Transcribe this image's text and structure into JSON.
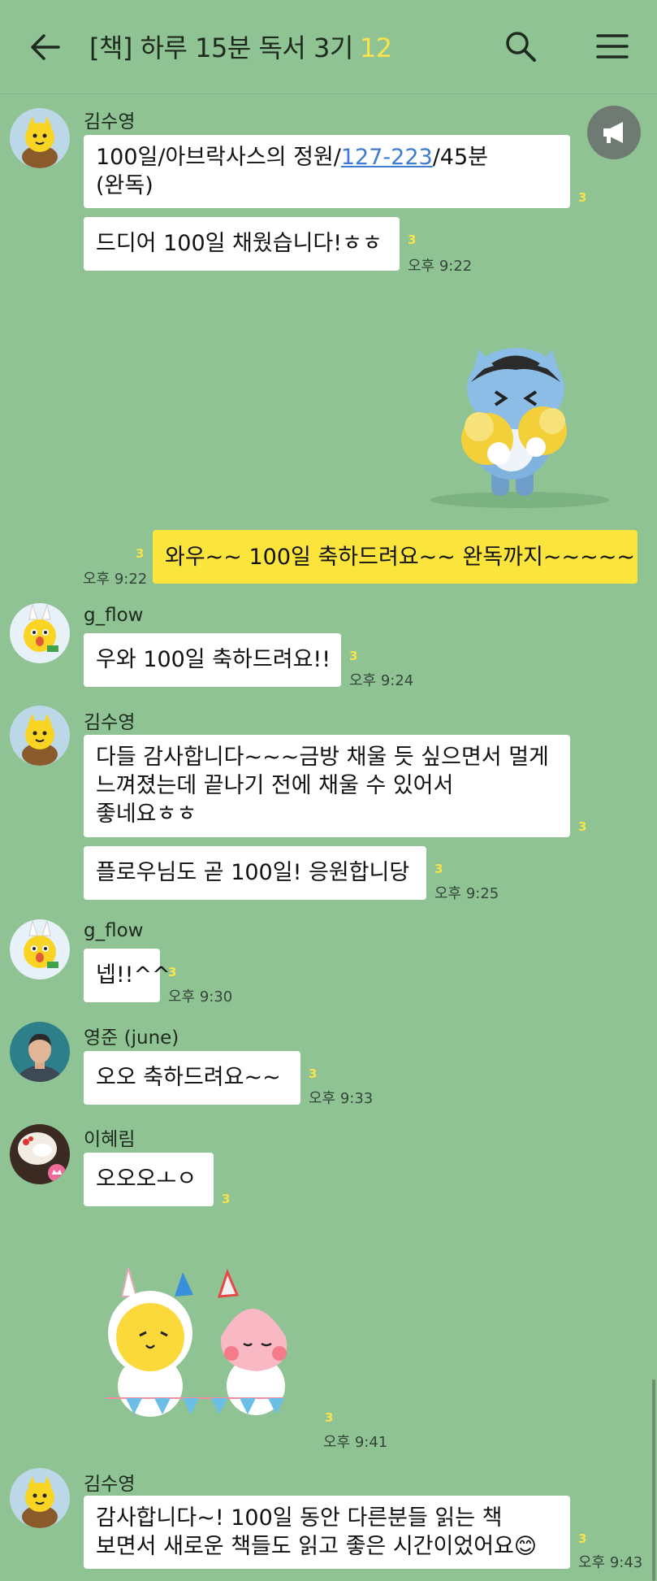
{
  "header": {
    "title": "[책] 하루 15분 독서 3기",
    "member_count": "12",
    "icons": [
      "back-arrow-icon",
      "search-icon",
      "menu-icon"
    ]
  },
  "colors": {
    "background": "#8FC394",
    "my_bubble": "#FBE53C",
    "other_bubble": "#FFFFFF",
    "unread": "#F8E34A",
    "link": "#3D7BD1"
  },
  "messages": {
    "m1": {
      "sender": "김수영",
      "line1_pre": "100일/아브락사스의 정원/",
      "line1_link": "127-223",
      "line1_post": "/45분",
      "line2": "(완독)",
      "unread": "3"
    },
    "m2": {
      "text": "드디어 100일 채웠습니다!ㅎㅎ",
      "unread": "3",
      "time": "오후 9:22"
    },
    "m3": {
      "type": "sticker",
      "sticker": "ryan-cheering-pompom-sticker"
    },
    "m4": {
      "text": "와우~~ 100일 축하드려요~~ 완독까지~~~~~",
      "unread": "3",
      "time": "오후 9:22"
    },
    "m5": {
      "sender": "g_flow",
      "text": "우와 100일 축하드려요!!",
      "unread": "3",
      "time": "오후 9:24"
    },
    "m6": {
      "sender": "김수영",
      "line1": "다들 감사합니다~~~금방 채울 듯 싶으면서 멀게",
      "line2": "느껴졌는데 끝나기 전에 채울 수 있어서",
      "line3": "좋네요ㅎㅎ",
      "unread": "3"
    },
    "m7": {
      "text": "플로우님도 곧 100일! 응원합니당",
      "unread": "3",
      "time": "오후 9:25"
    },
    "m8": {
      "sender": "g_flow",
      "text": "넵!!^^",
      "unread": "3",
      "time": "오후 9:30"
    },
    "m9": {
      "sender": "영준 (june)",
      "text": "오오 축하드려요~~",
      "unread": "3",
      "time": "오후 9:33"
    },
    "m10": {
      "sender": "이혜림",
      "text": "오오오ㅗㅇ",
      "unread": "3"
    },
    "m11": {
      "type": "sticker",
      "sticker": "muzi-apeach-happy-banner-sticker",
      "unread": "3",
      "time": "오후 9:41"
    },
    "m12": {
      "sender": "김수영",
      "line1": "감사합니다~! 100일 동안 다른분들 읽는 책",
      "line2": "보면서 새로운 책들도 읽고 좋은 시간이었어요😊",
      "unread": "3",
      "time": "오후 9:43"
    }
  }
}
